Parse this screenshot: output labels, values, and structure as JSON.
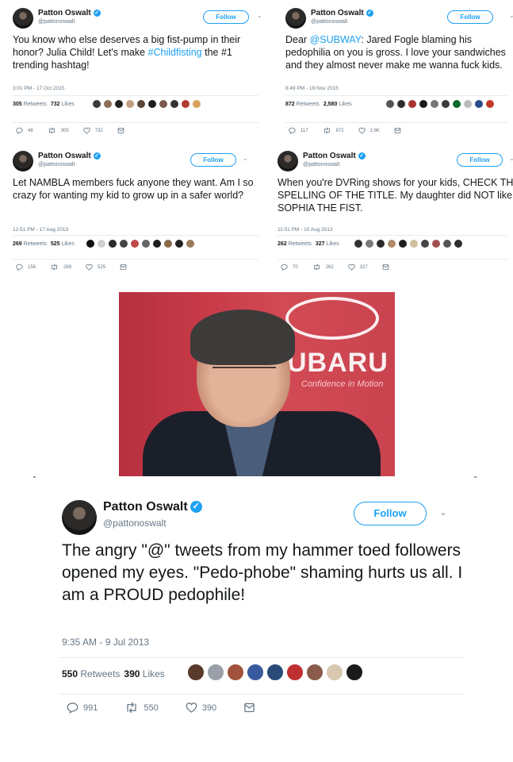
{
  "colors": {
    "accent": "#1da1f2",
    "text": "#14171a",
    "muted": "#657786"
  },
  "tweets": [
    {
      "name": "Patton Oswalt",
      "handle": "@pattonoswalt",
      "follow_label": "Follow",
      "text_before": "You know who else deserves a big fist-pump in their honor? Julia Child! Let's make ",
      "text_highlight": "#Childfisting",
      "text_after": " the #1 trending hashtag!",
      "timestamp": "3:01 PM - 17 Oct 2015",
      "retweets_count": "305",
      "retweets_label": "Retweets",
      "likes_count": "732",
      "likes_label": "Likes",
      "actions": {
        "reply": "48",
        "retweet": "305",
        "like": "732"
      }
    },
    {
      "name": "Patton Oswalt",
      "handle": "@pattonoswalt",
      "follow_label": "Follow",
      "text_before": "Dear ",
      "text_highlight": "@SUBWAY",
      "text_after": ": Jared Fogle blaming his pedophilia on you is gross. I love your sandwiches and they almost never make me wanna fuck kids.",
      "timestamp": "8:49 PM - 19 Nov 2015",
      "retweets_count": "872",
      "retweets_label": "Retweets",
      "likes_count": "2,580",
      "likes_label": "Likes",
      "actions": {
        "reply": "117",
        "retweet": "872",
        "like": "2.6K"
      }
    },
    {
      "name": "Patton Oswalt",
      "handle": "@pattonoswalt",
      "follow_label": "Follow",
      "text_before": "Let NAMBLA members fuck anyone they want. Am I so crazy for wanting my kid to grow up in a safer world?",
      "text_highlight": "",
      "text_after": "",
      "timestamp": "12:51 PM - 17 Aug 2013",
      "retweets_count": "269",
      "retweets_label": "Retweets",
      "likes_count": "525",
      "likes_label": "Likes",
      "actions": {
        "reply": "158",
        "retweet": "269",
        "like": "525"
      }
    },
    {
      "name": "Patton Oswalt",
      "handle": "@pattonoswalt",
      "follow_label": "Follow",
      "text_before": "When you're DVRing shows for your kids, CHECK THE SPELLING OF THE TITLE. My daughter did NOT like SOPHIA THE FIST.",
      "text_highlight": "",
      "text_after": "",
      "timestamp": "11:01 PM - 10 Aug 2013",
      "retweets_count": "262",
      "retweets_label": "Retweets",
      "likes_count": "327",
      "likes_label": "Likes",
      "actions": {
        "reply": "70",
        "retweet": "262",
        "like": "327"
      }
    },
    {
      "name": "Patton Oswalt",
      "handle": "@pattonoswalt",
      "follow_label": "Follow",
      "text_before": "The angry \"@\" tweets from my hammer toed followers opened my eyes. \"Pedo-phobe\" shaming hurts us all. I am a PROUD pedophile!",
      "text_highlight": "",
      "text_after": "",
      "timestamp": "9:35 AM - 9 Jul 2013",
      "retweets_count": "550",
      "retweets_label": "Retweets",
      "likes_count": "390",
      "likes_label": "Likes",
      "actions": {
        "reply": "991",
        "retweet": "550",
        "like": "390"
      }
    }
  ],
  "photo": {
    "logo_text": "UBARU",
    "logo_tagline": "Confidence in Motion"
  },
  "liker_colors": [
    [
      "#3b3b3b",
      "#8a6d5b",
      "#222",
      "#c0a080",
      "#5a4636",
      "#1e1e1e",
      "#7a5b4b",
      "#333",
      "#b23a2f",
      "#d9a05b"
    ],
    [
      "#555",
      "#2e2e2e",
      "#a33",
      "#1b1b1b",
      "#777",
      "#3a3a3a",
      "#0b6b2a",
      "#bbb",
      "#2a4a8a",
      "#c0392b"
    ],
    [
      "#111",
      "#cfcfcf",
      "#2a2a2a",
      "#444",
      "#c04a4a",
      "#666",
      "#1d1d1d",
      "#8b6b4b",
      "#222",
      "#9b7b5b"
    ],
    [
      "#333",
      "#7a7a7a",
      "#2b2b2b",
      "#b08a6a",
      "#1f1f1f",
      "#d0c0a0",
      "#444",
      "#a05050",
      "#555",
      "#2f2f2f"
    ],
    [
      "#5a3a2a",
      "#9aa0a8",
      "#a0523a",
      "#3a5aa0",
      "#2a4a7a",
      "#c03030",
      "#8a5a4a",
      "#d8c8b0",
      "#1a1a1a"
    ]
  ]
}
